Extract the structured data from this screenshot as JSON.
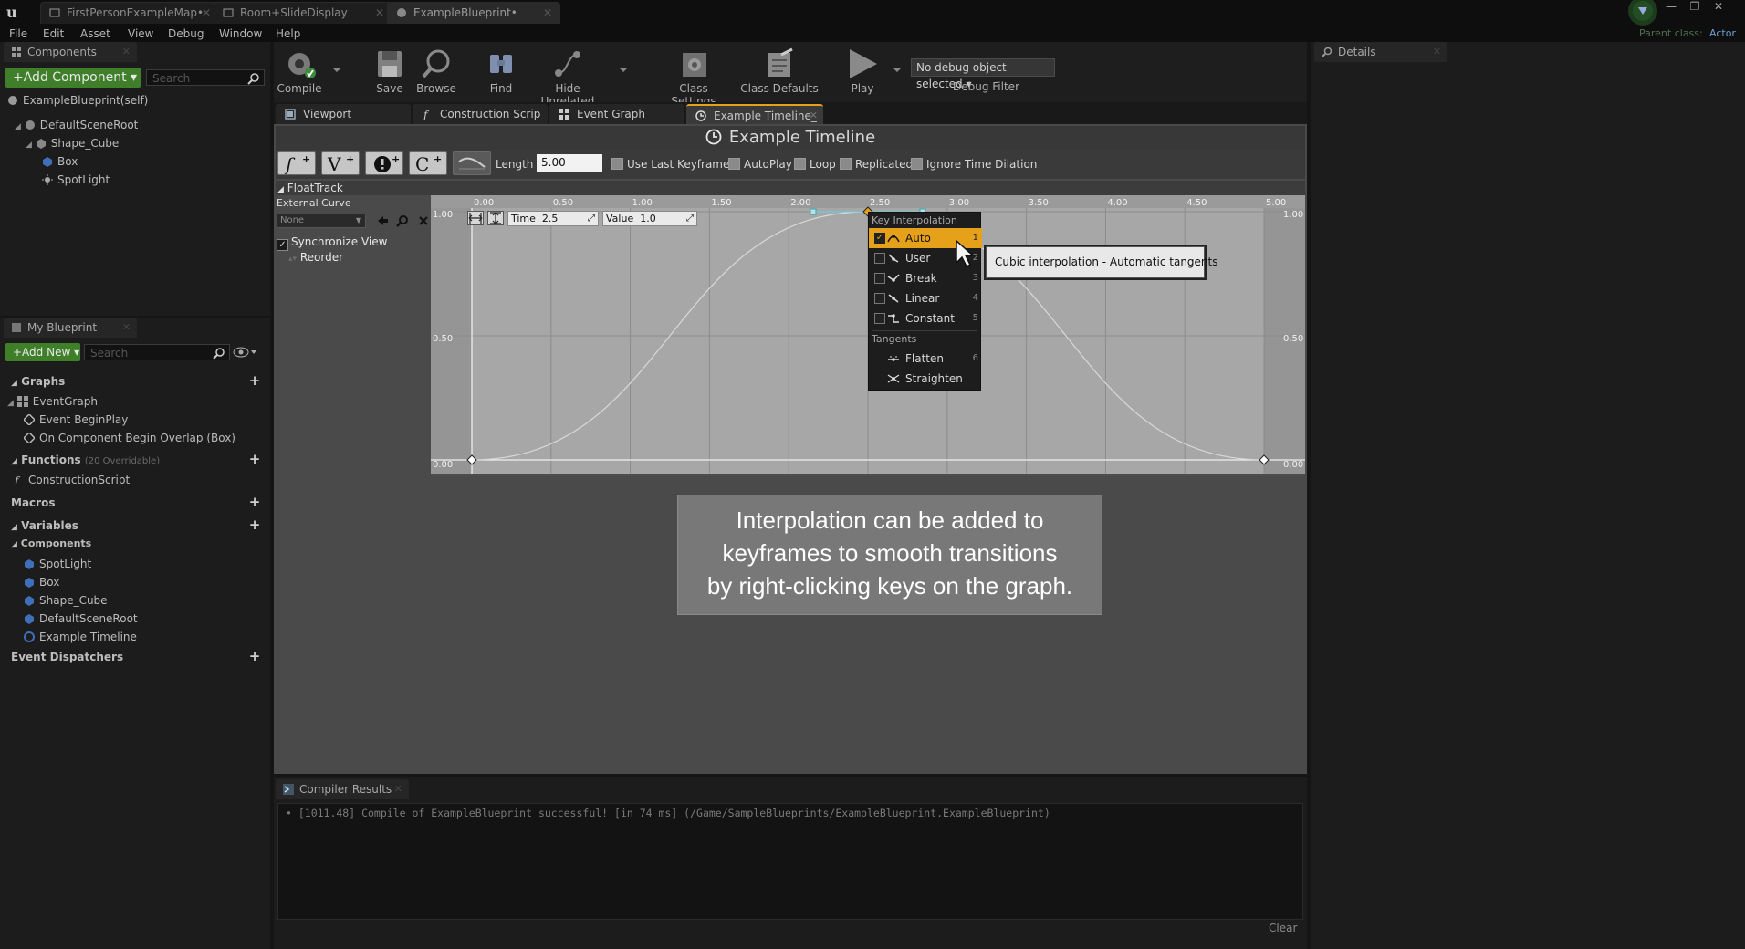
{
  "doc_tabs": [
    {
      "label": "FirstPersonExampleMap•"
    },
    {
      "label": "Room+SlideDisplay"
    },
    {
      "label": "ExampleBlueprint•"
    }
  ],
  "parent_class": {
    "label": "Parent class:",
    "value": "Actor"
  },
  "menu": [
    "File",
    "Edit",
    "Asset",
    "View",
    "Debug",
    "Window",
    "Help"
  ],
  "components_panel": {
    "tab": "Components",
    "add_button": "+Add Component ▾",
    "search_placeholder": "Search",
    "root": "ExampleBlueprint(self)",
    "tree": [
      "DefaultSceneRoot",
      "Shape_Cube",
      "Box",
      "SpotLight"
    ]
  },
  "my_blueprint": {
    "tab": "My Blueprint",
    "add_new": "+Add New ▾",
    "search_placeholder": "Search",
    "graphs_header": "Graphs",
    "graphs": [
      "EventGraph",
      "Event BeginPlay",
      "On Component Begin Overlap (Box)"
    ],
    "functions_header": "Functions",
    "functions_note": "(20 Overridable)",
    "functions": [
      "ConstructionScript"
    ],
    "macros_header": "Macros",
    "variables_header": "Variables",
    "components_header": "Components",
    "components": [
      "SpotLight",
      "Box",
      "Shape_Cube",
      "DefaultSceneRoot",
      "Example Timeline"
    ],
    "dispatchers_header": "Event Dispatchers"
  },
  "toolbar": {
    "compile": "Compile",
    "save": "Save",
    "browse": "Browse",
    "find": "Find",
    "hide_unrelated": "Hide Unrelated",
    "class_settings": "Class Settings",
    "class_defaults": "Class Defaults",
    "play": "Play",
    "debug_select": "No debug object selected ▾",
    "debug_filter": "Debug Filter"
  },
  "graph_tabs": [
    "Viewport",
    "Construction Scrip",
    "Event Graph",
    "Example Timeline_"
  ],
  "details_tab": "Details",
  "timeline": {
    "title": "Example Timeline",
    "length_label": "Length",
    "length_value": "5.00",
    "options": [
      "Use Last Keyframe?",
      "AutoPlay",
      "Loop",
      "Replicated",
      "Ignore Time Dilation"
    ],
    "track_name": "FloatTrack",
    "external_curve": "External Curve",
    "curve_select": "None",
    "sync_view": "Synchronize View",
    "reorder": "Reorder",
    "time_label": "Time",
    "time_value": "2.5",
    "value_label": "Value",
    "value_value": "1.0",
    "x_ticks": [
      "0.00",
      "0.50",
      "1.00",
      "1.50",
      "2.00",
      "2.50",
      "3.00",
      "3.50",
      "4.00",
      "4.50",
      "5.00"
    ],
    "y_left": [
      "1.00",
      "0.50",
      "0.00"
    ],
    "y_right": [
      "1.00",
      "0.50",
      "0.00"
    ]
  },
  "curve_keys": [
    {
      "time": 0.0,
      "value": 0.0
    },
    {
      "time": 2.5,
      "value": 1.0
    },
    {
      "time": 5.0,
      "value": 0.0
    }
  ],
  "context_menu": {
    "section1": "Key Interpolation",
    "items": [
      {
        "label": "Auto",
        "key": "1",
        "checked": "✓"
      },
      {
        "label": "User",
        "key": "2"
      },
      {
        "label": "Break",
        "key": "3"
      },
      {
        "label": "Linear",
        "key": "4"
      },
      {
        "label": "Constant",
        "key": "5"
      }
    ],
    "section2": "Tangents",
    "tangents": [
      {
        "label": "Flatten",
        "key": "6"
      },
      {
        "label": "Straighten",
        "key": ""
      }
    ]
  },
  "tooltip": "Cubic interpolation - Automatic tangents",
  "caption": [
    "Interpolation can be added to",
    "keyframes to smooth transitions",
    "by right-clicking keys on the graph."
  ],
  "compiler": {
    "tab": "Compiler Results",
    "message": "• [1011.48] Compile of ExampleBlueprint successful! [in 74 ms] (/Game/SampleBlueprints/ExampleBlueprint.ExampleBlueprint)",
    "clear": "Clear"
  },
  "colors": {
    "accent_orange": "#e6a11a",
    "add_green": "#3f7f2a",
    "timeline_bg": "#a7a7a7"
  }
}
